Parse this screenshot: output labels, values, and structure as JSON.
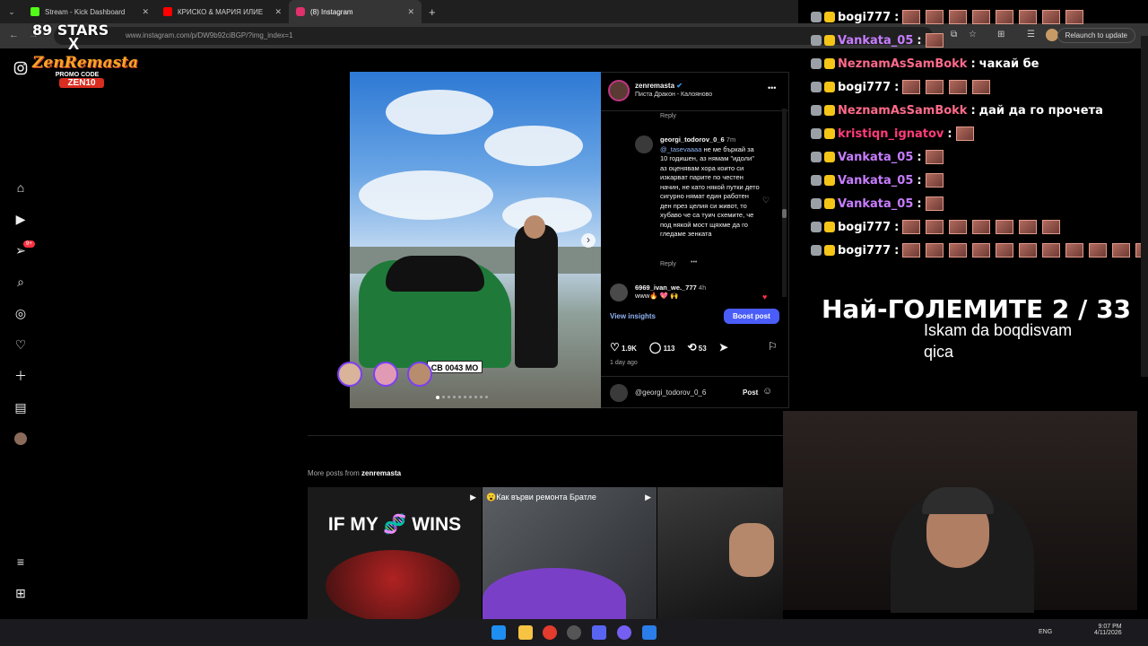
{
  "browser": {
    "tabs": [
      {
        "title": "Stream - Kick Dashboard",
        "color": "#53fc18"
      },
      {
        "title": "КРИСКО & МАРИЯ ИЛИЕ",
        "color": "#ff0000"
      },
      {
        "title": "(8) Instagram",
        "color": "#e1306c"
      }
    ],
    "new_tab": "+",
    "close_glyph": "✕",
    "url": "www.instagram.com/p/DW9b92ciBGP/?img_index=1",
    "relaunch": "Relaunch to update"
  },
  "overlay_logo": {
    "top": "89 STARS",
    "x": "X",
    "brand": "ZenRemasta",
    "promo": "PROMO CODE",
    "code": "ZEN10"
  },
  "ig_rail": {
    "icons": [
      "instagram-icon",
      "home-icon",
      "reels-icon",
      "messages-icon",
      "search-icon",
      "explore-icon",
      "notifications-icon",
      "create-icon",
      "dashboard-icon",
      "profile-icon",
      "menu-icon",
      "also-from-meta-icon"
    ],
    "messages_badge": "9+"
  },
  "post": {
    "username": "zenremasta",
    "location": "Писта Дракон - Калояново",
    "more": "•••",
    "reply_top": "Reply",
    "comment_author": "georgi_todorov_0_6",
    "comment_time": "7m",
    "comment_mention": "@_tasevaaaa",
    "comment_text": "не ме бъркай за 10 годишен, аз нямам \"идоли\" аз оценявам хора които си изкарват парите по честен начин, не като някой путки дето сигурно нямат един работен ден през целия си живот, то хубаво че са туич схемите, че под някой мост щяхме да го гледаме зенката",
    "reply_bottom": "Reply",
    "reply_more": "•••",
    "comment2_author": "6969_ivan_we._777",
    "comment2_time": "4h",
    "comment2_text": "www🔥 💖 🙌",
    "view_insights": "View insights",
    "boost": "Boost post",
    "likes": "1.9K",
    "comments": "113",
    "reposts": "53",
    "posted": "1 day ago",
    "commenter": "@georgi_todorov_0_6",
    "post_btn": "Post",
    "plate": "CB 0043 MO",
    "carousel_next": "›"
  },
  "more_posts": {
    "label_prefix": "More posts from",
    "label_user": "zenremasta",
    "thumb1_text": "IF MY 🧬 WINS",
    "thumb2_text": "😮Как върви ремонта Братле"
  },
  "chat": [
    {
      "user": "bogi777",
      "color": "#ffffff",
      "sep": ":",
      "message": "",
      "emotes": 8
    },
    {
      "user": "Vankata_05",
      "color": "#c77dff",
      "sep": ":",
      "message": "",
      "emotes": 1
    },
    {
      "user": "NeznamAsSamBokk",
      "color": "#ff6a8a",
      "sep": ":",
      "message": "чакай бе",
      "emotes": 0
    },
    {
      "user": "bogi777",
      "color": "#ffffff",
      "sep": ":",
      "message": "",
      "emotes": 4
    },
    {
      "user": "NeznamAsSamBokk",
      "color": "#ff6a8a",
      "sep": ":",
      "message": "дай да го прочета",
      "emotes": 0
    },
    {
      "user": "kristiqn_ignatov",
      "color": "#ff3c78",
      "sep": ":",
      "message": "",
      "emotes": 1
    },
    {
      "user": "Vankata_05",
      "color": "#c77dff",
      "sep": ":",
      "message": "",
      "emotes": 1
    },
    {
      "user": "Vankata_05",
      "color": "#c77dff",
      "sep": ":",
      "message": "",
      "emotes": 1
    },
    {
      "user": "Vankata_05",
      "color": "#c77dff",
      "sep": ":",
      "message": "",
      "emotes": 1
    },
    {
      "user": "bogi777",
      "color": "#ffffff",
      "sep": ":",
      "message": "",
      "emotes": 7
    },
    {
      "user": "bogi777",
      "color": "#ffffff",
      "sep": ":",
      "message": "",
      "emotes": 11
    }
  ],
  "stream_overlay": {
    "headline": "Най-ГОЛЕМИТЕ 2 / 33",
    "sub1": "Iskam da boqdisvam",
    "sub2": "qica"
  },
  "taskbar": {
    "lang": "ENG",
    "time": "9:07 PM",
    "date": "4/11/2026"
  }
}
